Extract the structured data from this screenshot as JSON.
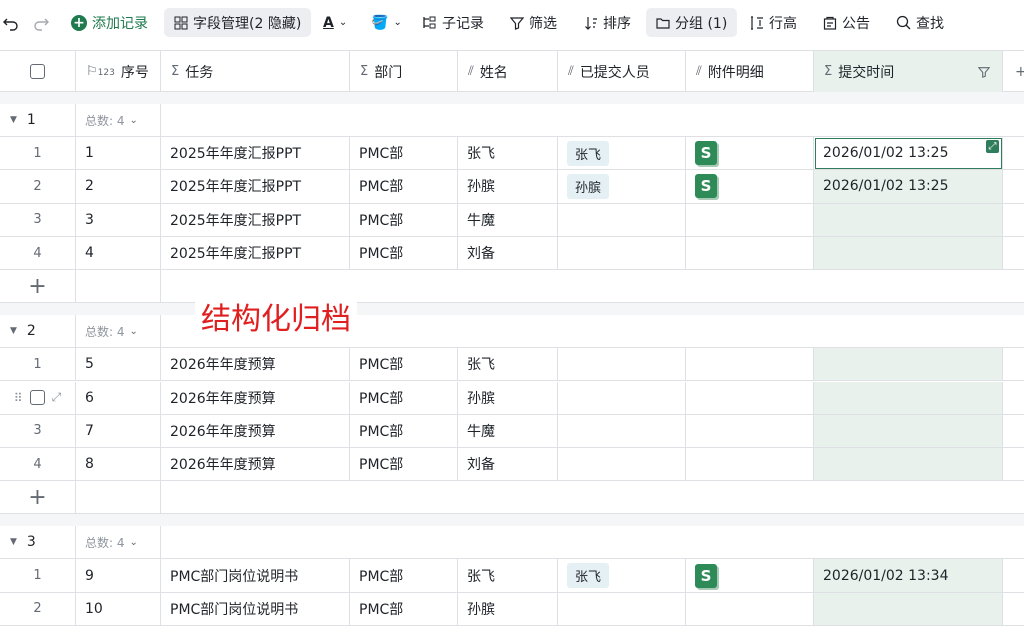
{
  "toolbar": {
    "undo_icon": "undo-icon",
    "redo_icon": "redo-icon",
    "add_record": "添加记录",
    "field_manage": "字段管理(2 隐藏)",
    "sub_record": "子记录",
    "filter": "筛选",
    "sort": "排序",
    "group": "分组 (1)",
    "row_height": "行高",
    "notice": "公告",
    "search": "查找"
  },
  "columns": {
    "seq": "序号",
    "seq_prefix": "123",
    "task": "任务",
    "dept": "部门",
    "name": "姓名",
    "submitted": "已提交人员",
    "attachment": "附件明细",
    "submit_time": "提交时间"
  },
  "groups": [
    {
      "num": "1",
      "count": "总数: 4",
      "rows": [
        {
          "idx": "1",
          "seq": "1",
          "task": "2025年年度汇报PPT",
          "dept": "PMC部",
          "name": "张飞",
          "submitted": "张飞",
          "attach": "S",
          "time": "2026/01/02 13:25"
        },
        {
          "idx": "2",
          "seq": "2",
          "task": "2025年年度汇报PPT",
          "dept": "PMC部",
          "name": "孙膑",
          "submitted": "孙膑",
          "attach": "S",
          "time": "2026/01/02 13:25"
        },
        {
          "idx": "3",
          "seq": "3",
          "task": "2025年年度汇报PPT",
          "dept": "PMC部",
          "name": "牛魔",
          "submitted": "",
          "attach": "",
          "time": ""
        },
        {
          "idx": "4",
          "seq": "4",
          "task": "2025年年度汇报PPT",
          "dept": "PMC部",
          "name": "刘备",
          "submitted": "",
          "attach": "",
          "time": ""
        }
      ]
    },
    {
      "num": "2",
      "count": "总数: 4",
      "rows": [
        {
          "idx": "1",
          "seq": "5",
          "task": "2026年年度预算",
          "dept": "PMC部",
          "name": "张飞",
          "submitted": "",
          "attach": "",
          "time": ""
        },
        {
          "idx": "2",
          "seq": "6",
          "task": "2026年年度预算",
          "dept": "PMC部",
          "name": "孙膑",
          "submitted": "",
          "attach": "",
          "time": ""
        },
        {
          "idx": "3",
          "seq": "7",
          "task": "2026年年度预算",
          "dept": "PMC部",
          "name": "牛魔",
          "submitted": "",
          "attach": "",
          "time": ""
        },
        {
          "idx": "4",
          "seq": "8",
          "task": "2026年年度预算",
          "dept": "PMC部",
          "name": "刘备",
          "submitted": "",
          "attach": "",
          "time": ""
        }
      ]
    },
    {
      "num": "3",
      "count": "总数: 4",
      "rows": [
        {
          "idx": "1",
          "seq": "9",
          "task": "PMC部门岗位说明书",
          "dept": "PMC部",
          "name": "张飞",
          "submitted": "张飞",
          "attach": "S",
          "time": "2026/01/02 13:34"
        },
        {
          "idx": "2",
          "seq": "10",
          "task": "PMC部门岗位说明书",
          "dept": "PMC部",
          "name": "孙膑",
          "submitted": "",
          "attach": "",
          "time": ""
        }
      ]
    }
  ],
  "watermark": "结构化归档",
  "colors": {
    "accent": "#1f7a4d",
    "selected_col": "#e8f1ec",
    "tag_bg": "#e5f0f5",
    "watermark": "#e02020"
  }
}
